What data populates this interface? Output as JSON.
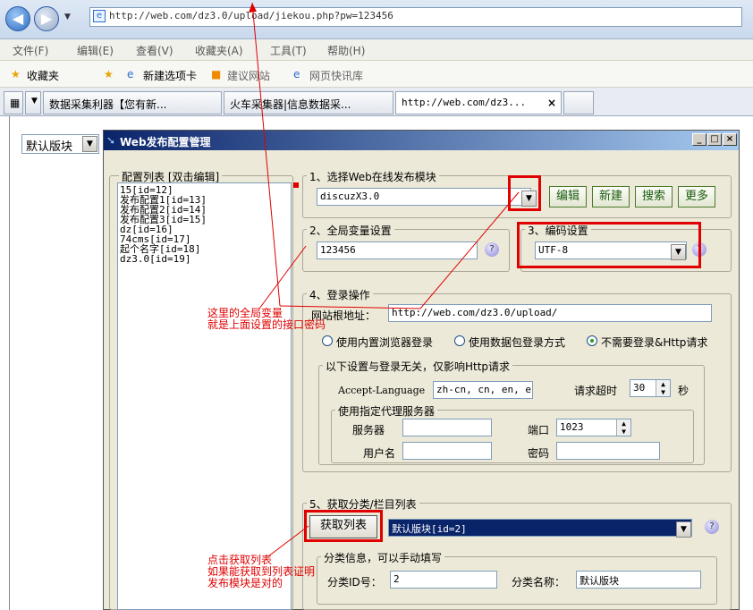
{
  "browser": {
    "url": "http://web.com/dz3.0/upload/jiekou.php?pw=123456",
    "menu": [
      "文件(F)",
      "编辑(E)",
      "查看(V)",
      "收藏夹(A)",
      "工具(T)",
      "帮助(H)"
    ],
    "favorites": [
      "收藏夹",
      "新建选项卡",
      "建议网站",
      "网页快讯库"
    ],
    "tabs": [
      "数据采集利器【您有新...",
      "火车采集器|信息数据采...",
      "http://web.com/dz3..."
    ],
    "close_tab": "×"
  },
  "left_select": {
    "value": "默认版块"
  },
  "window": {
    "title": "Web发布配置管理",
    "controls": [
      "_",
      "□",
      "×"
    ],
    "list_group": "配置列表  [双击编辑]",
    "list_items": [
      "15[id=12]",
      "发布配置1[id=13]",
      "发布配置2[id=14]",
      "发布配置3[id=15]",
      "dz[id=16]",
      "74cms[id=17]",
      "起个名字[id=18]",
      "dz3.0[id=19]"
    ],
    "section1": {
      "label": "1、选择Web在线发布模块",
      "module": "discuzX3.0",
      "buttons": [
        "编辑",
        "新建",
        "搜索",
        "更多"
      ]
    },
    "section2": {
      "label": "2、全局变量设置",
      "value": "123456"
    },
    "section3": {
      "label": "3、编码设置",
      "value": "UTF-8"
    },
    "section4": {
      "label": "4、登录操作",
      "root_label": "网站根地址：",
      "root_value": "http://web.com/dz3.0/upload/",
      "radios": [
        "使用内置浏览器登录",
        "使用数据包登录方式",
        "不需要登录&Http请求"
      ],
      "http_group": "以下设置与登录无关，仅影响Http请求",
      "accept_label": "Accept-Language",
      "accept_value": "zh-cn, cn, en, en-us",
      "timeout_label": "请求超时",
      "timeout_value": "30",
      "timeout_unit": "秒",
      "proxy_group": "使用指定代理服务器",
      "server_label": "服务器",
      "server_value": "",
      "port_label": "端口",
      "port_value": "1023",
      "user_label": "用户名",
      "user_value": "",
      "pass_label": "密码",
      "pass_value": ""
    },
    "section5": {
      "label": "5、获取分类/栏目列表",
      "fetch_button": "获取列表",
      "category_value": "默认版块[id=2]",
      "info_group": "分类信息，可以手动填写",
      "id_label": "分类ID号：",
      "id_value": "2",
      "name_label": "分类名称：",
      "name_value": "默认版块"
    }
  },
  "annotations": {
    "global_var": [
      "这里的全局变量",
      "就是上面设置的接口密码"
    ],
    "fetch": [
      "点击获取列表",
      "如果能获取到列表证明",
      "发布模块是对的"
    ]
  },
  "colors": {
    "annotation": "#e00000",
    "title_bar": "#0a246a"
  }
}
